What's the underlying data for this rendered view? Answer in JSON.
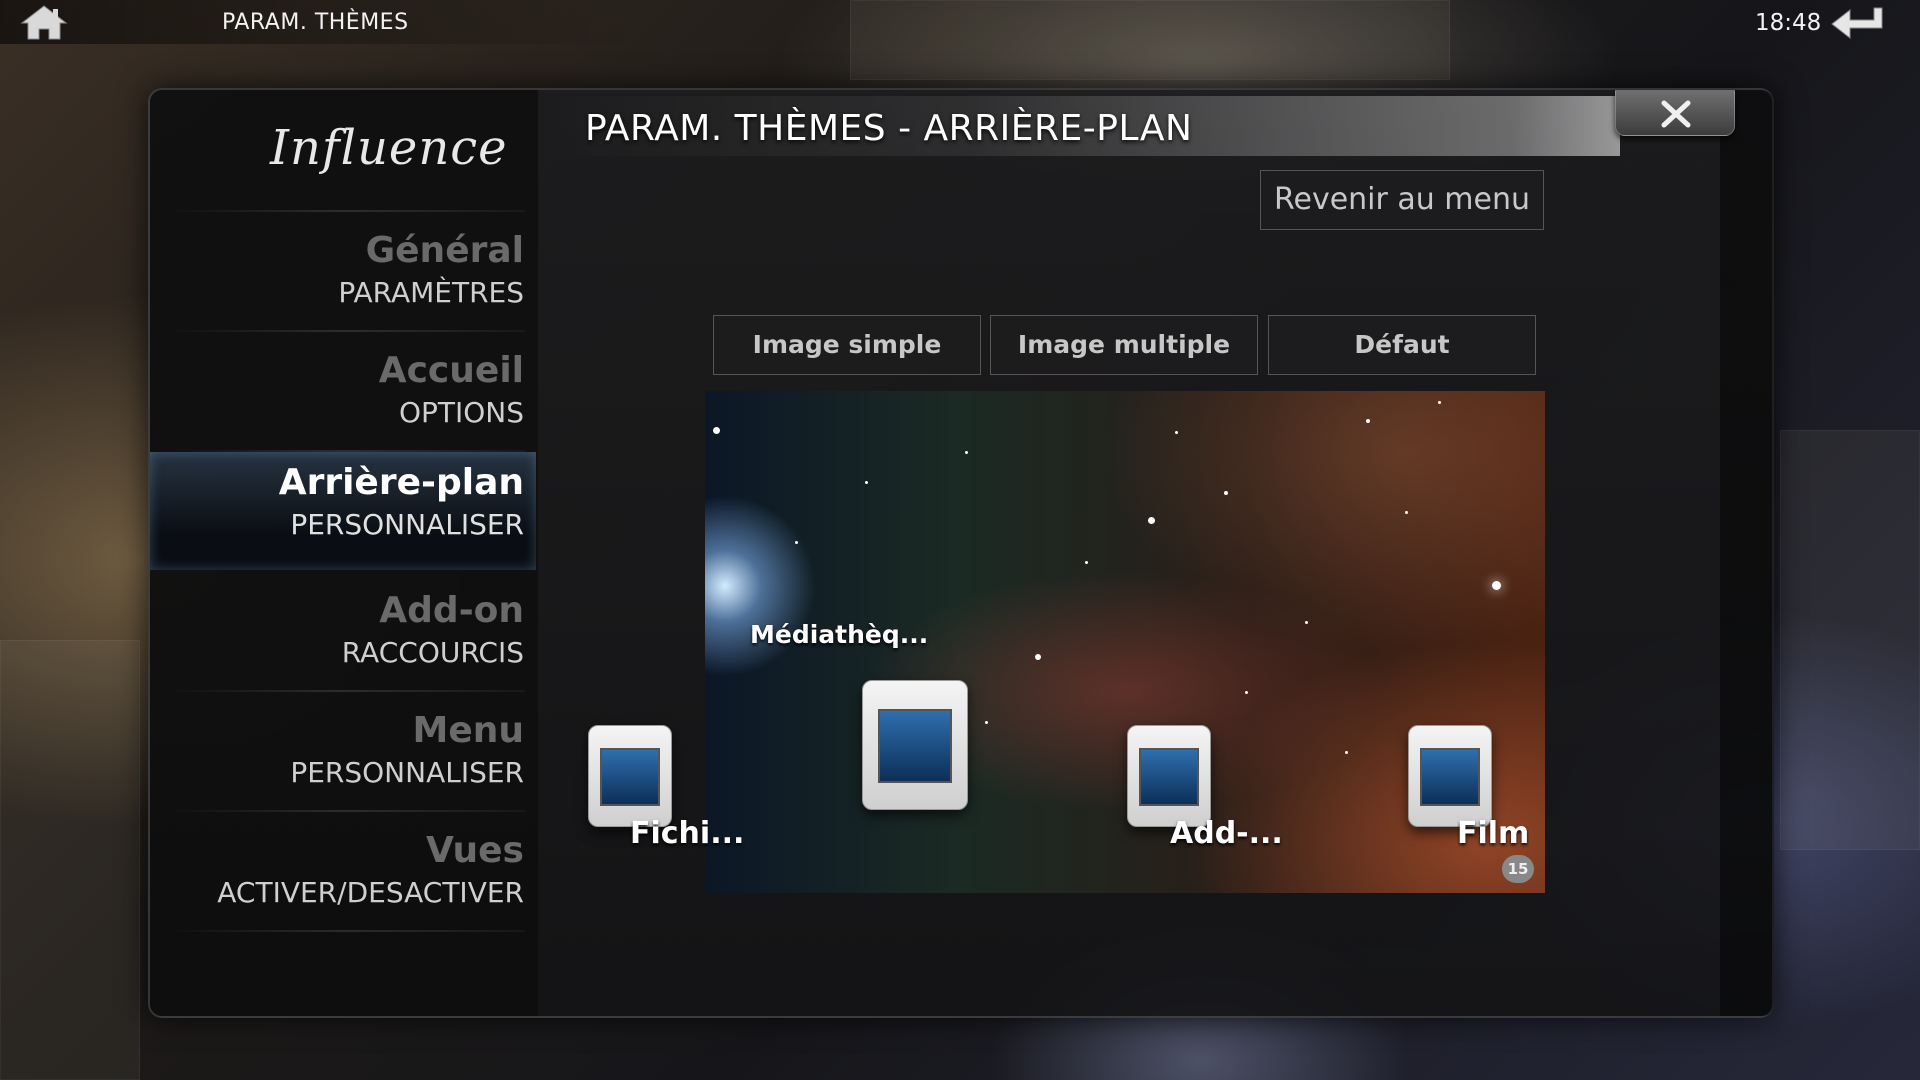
{
  "topbar": {
    "breadcrumb": "PARAM. THÈMES",
    "time": "18:48",
    "home_icon": "home-icon",
    "back_icon": "back-arrow-icon"
  },
  "logo": "Influence",
  "dialog": {
    "title": "PARAM. THÈMES - ARRIÈRE-PLAN",
    "close_icon": "close-icon",
    "return_button": "Revenir au menu"
  },
  "sidebar": {
    "items": [
      {
        "title": "Général",
        "subtitle": "PARAMÈTRES",
        "active": false
      },
      {
        "title": "Accueil",
        "subtitle": "OPTIONS",
        "active": false
      },
      {
        "title": "Arrière-plan",
        "subtitle": "PERSONNALISER",
        "active": true
      },
      {
        "title": "Add-on",
        "subtitle": "RACCOURCIS",
        "active": false
      },
      {
        "title": "Menu",
        "subtitle": "PERSONNALISER",
        "active": false
      },
      {
        "title": "Vues",
        "subtitle": "ACTIVER/DESACTIVER",
        "active": false
      }
    ]
  },
  "options": {
    "single": "Image simple",
    "multiple": "Image multiple",
    "default": "Défaut"
  },
  "preview": {
    "focused_label": "Médiathèq...",
    "items": [
      {
        "label": "Fichi...",
        "icon": "files-icon"
      },
      {
        "label": "",
        "icon": "media-library-icon"
      },
      {
        "label": "Add-...",
        "icon": "addons-puzzle-icon"
      },
      {
        "label": "Films",
        "icon": "movies-icon"
      }
    ],
    "badge": "15"
  },
  "colors": {
    "accent_active": "#2a3c4f",
    "inactive_title": "#6a6a6a"
  }
}
